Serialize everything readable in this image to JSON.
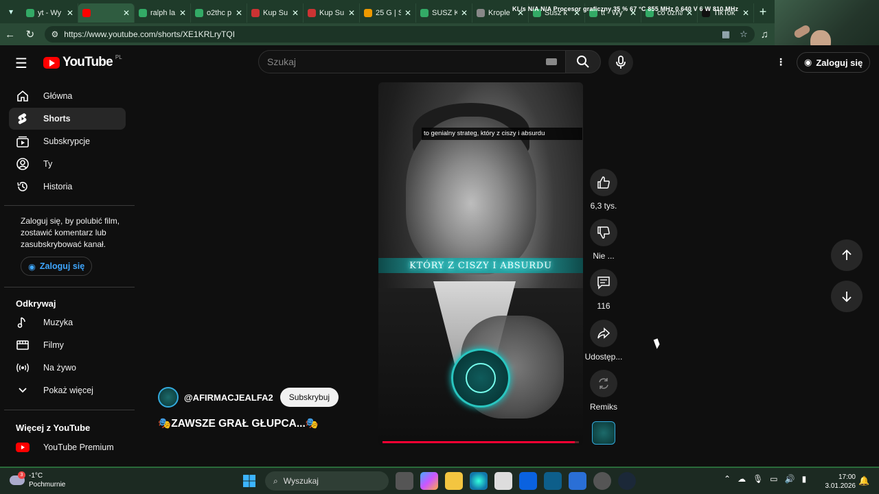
{
  "browser": {
    "tabs": [
      {
        "label": "yt - Wy",
        "color": "#3a6"
      },
      {
        "label": "",
        "color": "#f00"
      },
      {
        "label": "ralph la",
        "color": "#3a6"
      },
      {
        "label": "o2thc p",
        "color": "#3a6"
      },
      {
        "label": "Kup Su",
        "color": "#c33"
      },
      {
        "label": "Kup Su",
        "color": "#c33"
      },
      {
        "label": "25 G | S",
        "color": "#e90"
      },
      {
        "label": "SUSZ K",
        "color": "#3a6"
      },
      {
        "label": "Krople",
        "color": "#888"
      },
      {
        "label": "Susz k",
        "color": "#3a6"
      },
      {
        "label": "tt - Wy",
        "color": "#3a6"
      },
      {
        "label": "co ozna",
        "color": "#3a6"
      },
      {
        "label": "TikTok",
        "color": "#111"
      }
    ],
    "new_tab": "+",
    "url": "https://www.youtube.com/shorts/XE1KRLryTQI",
    "stats_overlay": "Kl./s N/A  N/A  Procesor graficzny  35 %  67 °C  855 MHz  0.640 V  6 W  810 MHz"
  },
  "youtube": {
    "logo_text": "YouTube",
    "country_code": "PL",
    "search_placeholder": "Szukaj",
    "signin_top": "Zaloguj się",
    "sidebar": {
      "items": [
        {
          "label": "Główna",
          "icon": "home-icon"
        },
        {
          "label": "Shorts",
          "icon": "shorts-icon"
        },
        {
          "label": "Subskrypcje",
          "icon": "subscriptions-icon"
        },
        {
          "label": "Ty",
          "icon": "user-icon"
        },
        {
          "label": "Historia",
          "icon": "history-icon"
        }
      ],
      "promo": "Zaloguj się, by polubić film, zostawić komentarz lub zasubskrybować kanał.",
      "promo_button": "Zaloguj się",
      "explore_heading": "Odkrywaj",
      "explore_items": [
        {
          "label": "Muzyka",
          "icon": "music-icon"
        },
        {
          "label": "Filmy",
          "icon": "film-icon"
        },
        {
          "label": "Na żywo",
          "icon": "live-icon"
        },
        {
          "label": "Pokaż więcej",
          "icon": "chevron-down-icon"
        }
      ],
      "more_heading": "Więcej z YouTube",
      "more_items": [
        {
          "label": "YouTube Premium",
          "icon": "youtube-premium-icon"
        }
      ]
    },
    "short": {
      "caption_top": "to genialny strateg, który z ciszy i absurdu",
      "caption_glow": "KTÓRY Z CISZY I ABSURDU",
      "progress_percent": 98,
      "channel": "@AFIRMACJEALFA2",
      "subscribe": "Subskrybuj",
      "title": "🎭ZAWSZE GRAŁ GŁUPCA...🎭"
    },
    "actions": {
      "like_count": "6,3 tys.",
      "dislike_label": "Nie ...",
      "comments_count": "116",
      "share_label": "Udostęp...",
      "remix_label": "Remiks"
    }
  },
  "taskbar": {
    "weather_temp": "-1°C",
    "weather_desc": "Pochmurnie",
    "weather_badge": "3",
    "search": "Wyszukaj",
    "time": "17:00",
    "date": "3.01.2026"
  }
}
